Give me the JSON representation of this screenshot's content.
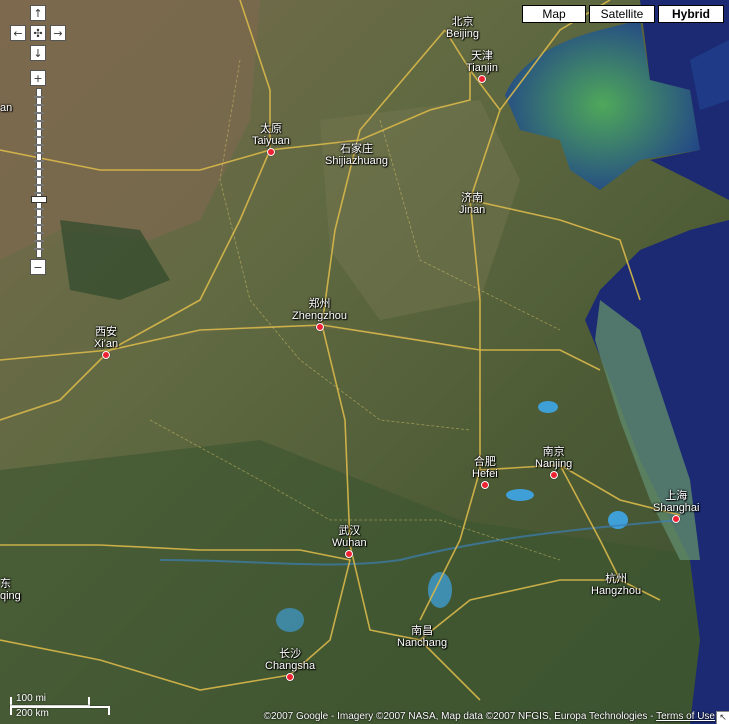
{
  "map_types": [
    {
      "label": "Map",
      "active": false
    },
    {
      "label": "Satellite",
      "active": false
    },
    {
      "label": "Hybrid",
      "active": true
    }
  ],
  "controls": {
    "pan_up": "↑",
    "pan_left": "←",
    "pan_center": "✣",
    "pan_right": "→",
    "pan_down": "↓",
    "zoom_in": "+",
    "zoom_out": "−"
  },
  "cities": [
    {
      "zh": "北京",
      "en": "Beijing"
    },
    {
      "zh": "天津",
      "en": "Tianjin"
    },
    {
      "zh": "太原",
      "en": "Taiyuan"
    },
    {
      "zh": "石家庄",
      "en": "Shijiazhuang"
    },
    {
      "zh": "济南",
      "en": "Jinan"
    },
    {
      "zh": "郑州",
      "en": "Zhengzhou"
    },
    {
      "zh": "西安",
      "en": "Xi'an"
    },
    {
      "zh": "南京",
      "en": "Nanjing"
    },
    {
      "zh": "合肥",
      "en": "Hefei"
    },
    {
      "zh": "上海",
      "en": "Shanghai"
    },
    {
      "zh": "武汉",
      "en": "Wuhan"
    },
    {
      "zh": "杭州",
      "en": "Hangzhou"
    },
    {
      "zh": "南昌",
      "en": "Nanchang"
    },
    {
      "zh": "长沙",
      "en": "Changsha"
    }
  ],
  "edge_labels": {
    "left_top": "an",
    "left_mid_zh": "东",
    "left_mid_en": "qing"
  },
  "scale": {
    "miles": "100 mi",
    "km": "200 km"
  },
  "copyright": "©2007 Google - Imagery ©2007 NASA, Map data ©2007 NFGIS, Europa Technologies - ",
  "terms": "Terms of Use",
  "colors": {
    "sea": "#1a2a6e",
    "land": "#5d6640",
    "road": "#d9b84a",
    "city_dot": "#e23344"
  }
}
